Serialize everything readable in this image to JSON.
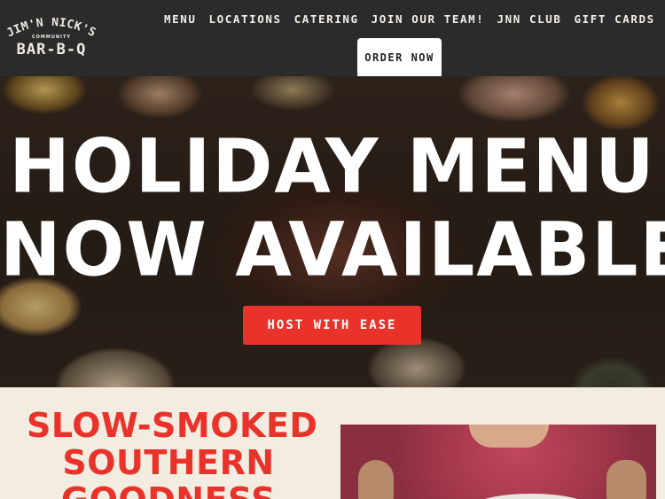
{
  "header": {
    "logo": {
      "name_text": "JIM'N NICK'S",
      "community_text": "COMMUNITY",
      "bbq_text": "BAR-B-Q"
    },
    "nav": [
      "MENU",
      "LOCATIONS",
      "CATERING",
      "JOIN OUR TEAM!",
      "JNN CLUB",
      "GIFT CARDS"
    ],
    "order_button": "ORDER NOW"
  },
  "hero": {
    "title_line1": "HOLIDAY MENU",
    "title_line2": "NOW AVAILABLE",
    "cta_button": "HOST WITH EASE"
  },
  "section": {
    "heading_line1": "SLOW-SMOKED",
    "heading_line2": "SOUTHERN",
    "heading_line3": "GOODNESS"
  },
  "colors": {
    "header_bg": "#2b2b2b",
    "accent_red": "#e8322a",
    "cream": "#f3ece0"
  }
}
